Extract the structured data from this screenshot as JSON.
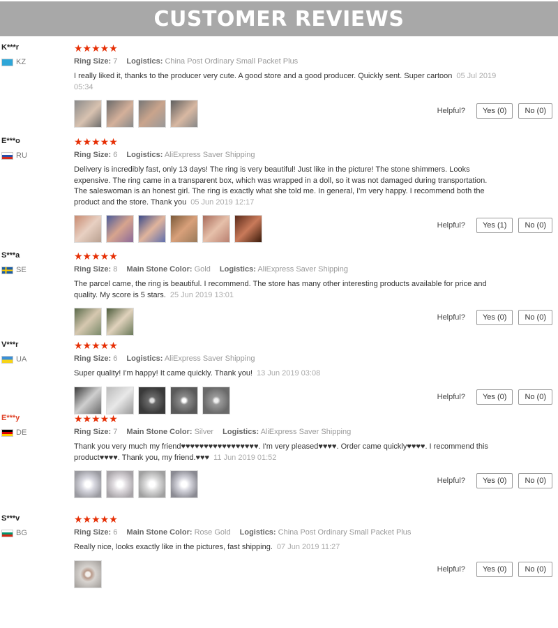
{
  "header": {
    "title": "CUSTOMER REVIEWS"
  },
  "helpful_label": "Helpful?",
  "reviews": [
    {
      "user": "K***r",
      "country": "KZ",
      "stars": "★★★★★",
      "attrs": [
        {
          "label": "Ring Size:",
          "value": "7"
        },
        {
          "label": "Logistics:",
          "value": "China Post Ordinary Small Packet Plus"
        }
      ],
      "text": "I really liked it, thanks to the producer very cute. A good store and a good producer. Quickly sent. Super cartoon",
      "date": "05 Jul 2019 05:34",
      "photo_count": 4,
      "yes": "Yes (0)",
      "no": "No (0)"
    },
    {
      "user": "E***o",
      "country": "RU",
      "stars": "★★★★★",
      "attrs": [
        {
          "label": "Ring Size:",
          "value": "6"
        },
        {
          "label": "Logistics:",
          "value": "AliExpress Saver Shipping"
        }
      ],
      "text": "Delivery is incredibly fast, only 13 days! The ring is very beautiful! Just like in the picture! The stone shimmers. Looks expensive. The ring came in a transparent box, which was wrapped in a doll, so it was not damaged during transportation. The saleswoman is an honest girl. The ring is exactly what she told me. In general, I'm very happy. I recommend both the product and the store. Thank you",
      "date": "05 Jun 2019 12:17",
      "photo_count": 6,
      "yes": "Yes (1)",
      "no": "No (0)"
    },
    {
      "user": "S***a",
      "country": "SE",
      "stars": "★★★★★",
      "attrs": [
        {
          "label": "Ring Size:",
          "value": "8"
        },
        {
          "label": "Main Stone Color:",
          "value": "Gold"
        },
        {
          "label": "Logistics:",
          "value": "AliExpress Saver Shipping"
        }
      ],
      "text": "The parcel came, the ring is beautiful. I recommend. The store has many other interesting products available for price and quality. My score is 5 stars.",
      "date": "25 Jun 2019 13:01",
      "photo_count": 2,
      "yes": "Yes (0)",
      "no": "No (0)"
    },
    {
      "user": "V***r",
      "country": "UA",
      "stars": "★★★★★",
      "attrs": [
        {
          "label": "Ring Size:",
          "value": "6"
        },
        {
          "label": "Logistics:",
          "value": "AliExpress Saver Shipping"
        }
      ],
      "text": "Super quality! I'm happy! It came quickly. Thank you!",
      "date": "13 Jun 2019 03:08",
      "photo_count": 5,
      "yes": "Yes (0)",
      "no": "No (0)"
    },
    {
      "user": "E***y",
      "country": "DE",
      "stars": "★★★★★",
      "attrs": [
        {
          "label": "Ring Size:",
          "value": "7"
        },
        {
          "label": "Main Stone Color:",
          "value": "Silver"
        },
        {
          "label": "Logistics:",
          "value": "AliExpress Saver Shipping"
        }
      ],
      "text": "Thank you very much my friend♥♥♥♥♥♥♥♥♥♥♥♥♥♥♥♥♥. I'm very pleased♥♥♥♥. Order came quickly♥♥♥♥. I recommend this product♥♥♥♥. Thank you, my friend.♥♥♥",
      "date": "11 Jun 2019 01:52",
      "photo_count": 4,
      "yes": "Yes (0)",
      "no": "No (0)"
    },
    {
      "user": "S***v",
      "country": "BG",
      "stars": "★★★★★",
      "attrs": [
        {
          "label": "Ring Size:",
          "value": "6"
        },
        {
          "label": "Main Stone Color:",
          "value": "Rose Gold"
        },
        {
          "label": "Logistics:",
          "value": "China Post Ordinary Small Packet Plus"
        }
      ],
      "text": "Really nice, looks exactly like in the pictures, fast shipping.",
      "date": "07 Jun 2019 11:27",
      "photo_count": 1,
      "yes": "Yes (0)",
      "no": "No (0)"
    }
  ]
}
